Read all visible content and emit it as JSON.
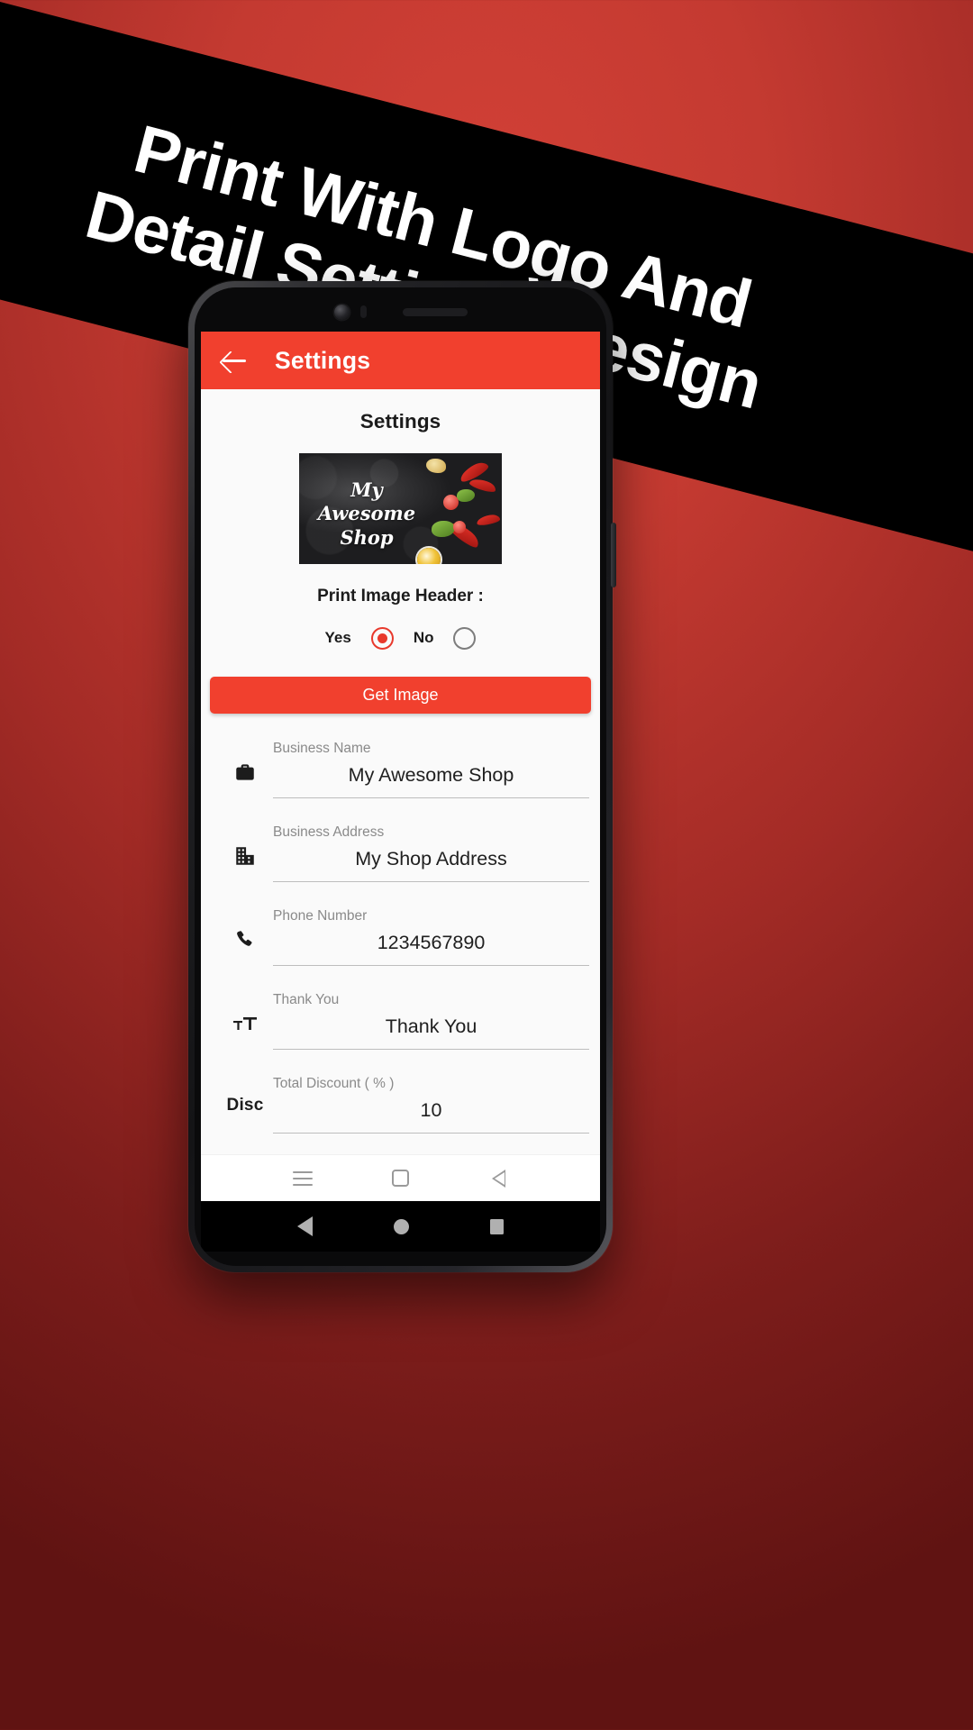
{
  "promo": {
    "line1": "Print With Logo And",
    "line2": "Detail Settings Design"
  },
  "app": {
    "accent_color": "#f1402e",
    "appbar": {
      "back_icon": "back-arrow-icon",
      "title": "Settings"
    },
    "page_title": "Settings",
    "logo": {
      "line1": "My Awesome",
      "line2": "Shop",
      "alt": "shop-logo-banner"
    },
    "print_header": {
      "label": "Print Image Header :",
      "options": [
        {
          "label": "Yes",
          "selected": true
        },
        {
          "label": "No",
          "selected": false
        }
      ]
    },
    "get_image_button": "Get Image",
    "fields": [
      {
        "icon": "briefcase-icon",
        "icon_text": "",
        "label": "Business Name",
        "value": "My Awesome Shop"
      },
      {
        "icon": "building-icon",
        "icon_text": "",
        "label": "Business Address",
        "value": "My Shop Address"
      },
      {
        "icon": "phone-icon",
        "icon_text": "",
        "label": "Phone Number",
        "value": "1234567890"
      },
      {
        "icon": "format-size-icon",
        "icon_text": "",
        "label": "Thank You",
        "value": "Thank You"
      },
      {
        "icon": "discount-text-icon",
        "icon_text": "Disc",
        "label": "Total Discount ( % )",
        "value": "10"
      }
    ],
    "soft_nav": [
      {
        "icon": "menu-icon"
      },
      {
        "icon": "square-overview-icon"
      },
      {
        "icon": "back-triangle-icon"
      }
    ]
  },
  "device_nav": [
    {
      "icon": "device-back-icon"
    },
    {
      "icon": "device-home-icon"
    },
    {
      "icon": "device-recents-icon"
    }
  ]
}
